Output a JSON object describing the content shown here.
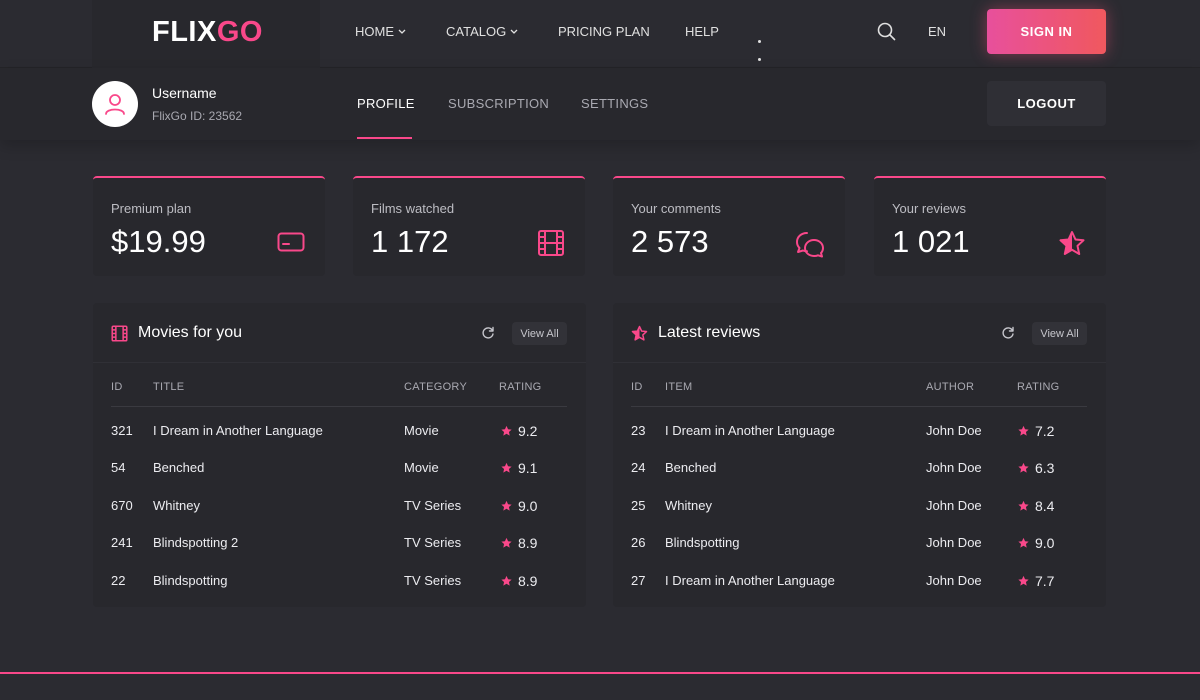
{
  "brand": {
    "logo_part1": "FLIX",
    "logo_part2": "GO"
  },
  "nav": {
    "items": [
      {
        "label": "HOME",
        "has_dropdown": true
      },
      {
        "label": "CATALOG",
        "has_dropdown": true
      },
      {
        "label": "PRICING PLAN",
        "has_dropdown": false
      },
      {
        "label": "HELP",
        "has_dropdown": false
      }
    ],
    "more_icon": "more-dots-icon",
    "search_icon": "search-icon",
    "language": "EN",
    "signin_label": "SIGN IN"
  },
  "profile": {
    "username": "Username",
    "user_id": "FlixGo ID: 23562",
    "tabs": [
      {
        "label": "PROFILE",
        "active": true
      },
      {
        "label": "SUBSCRIPTION",
        "active": false
      },
      {
        "label": "SETTINGS",
        "active": false
      }
    ],
    "logout_label": "LOGOUT"
  },
  "stats": [
    {
      "label": "Premium plan",
      "value": "$19.99",
      "icon": "credit-card-icon"
    },
    {
      "label": "Films watched",
      "value": "1 172",
      "icon": "film-icon"
    },
    {
      "label": "Your comments",
      "value": "2 573",
      "icon": "comments-icon"
    },
    {
      "label": "Your reviews",
      "value": "1 021",
      "icon": "star-icon"
    }
  ],
  "movies_panel": {
    "title": "Movies for you",
    "view_all": "View All",
    "columns": [
      "ID",
      "TITLE",
      "CATEGORY",
      "RATING"
    ],
    "rows": [
      {
        "id": "321",
        "title": "I Dream in Another Language",
        "category": "Movie",
        "rating": "9.2"
      },
      {
        "id": "54",
        "title": "Benched",
        "category": "Movie",
        "rating": "9.1"
      },
      {
        "id": "670",
        "title": "Whitney",
        "category": "TV Series",
        "rating": "9.0"
      },
      {
        "id": "241",
        "title": "Blindspotting 2",
        "category": "TV Series",
        "rating": "8.9"
      },
      {
        "id": "22",
        "title": "Blindspotting",
        "category": "TV Series",
        "rating": "8.9"
      }
    ]
  },
  "reviews_panel": {
    "title": "Latest reviews",
    "view_all": "View All",
    "columns": [
      "ID",
      "ITEM",
      "AUTHOR",
      "RATING"
    ],
    "rows": [
      {
        "id": "23",
        "item": "I Dream in Another Language",
        "author": "John Doe",
        "rating": "7.2"
      },
      {
        "id": "24",
        "item": "Benched",
        "author": "John Doe",
        "rating": "6.3"
      },
      {
        "id": "25",
        "item": "Whitney",
        "author": "John Doe",
        "rating": "8.4"
      },
      {
        "id": "26",
        "item": "Blindspotting",
        "author": "John Doe",
        "rating": "9.0"
      },
      {
        "id": "27",
        "item": "I Dream in Another Language",
        "author": "John Doe",
        "rating": "7.7"
      }
    ]
  },
  "colors": {
    "accent": "#f9488a",
    "background": "#2b2b31",
    "card": "#28282d"
  }
}
